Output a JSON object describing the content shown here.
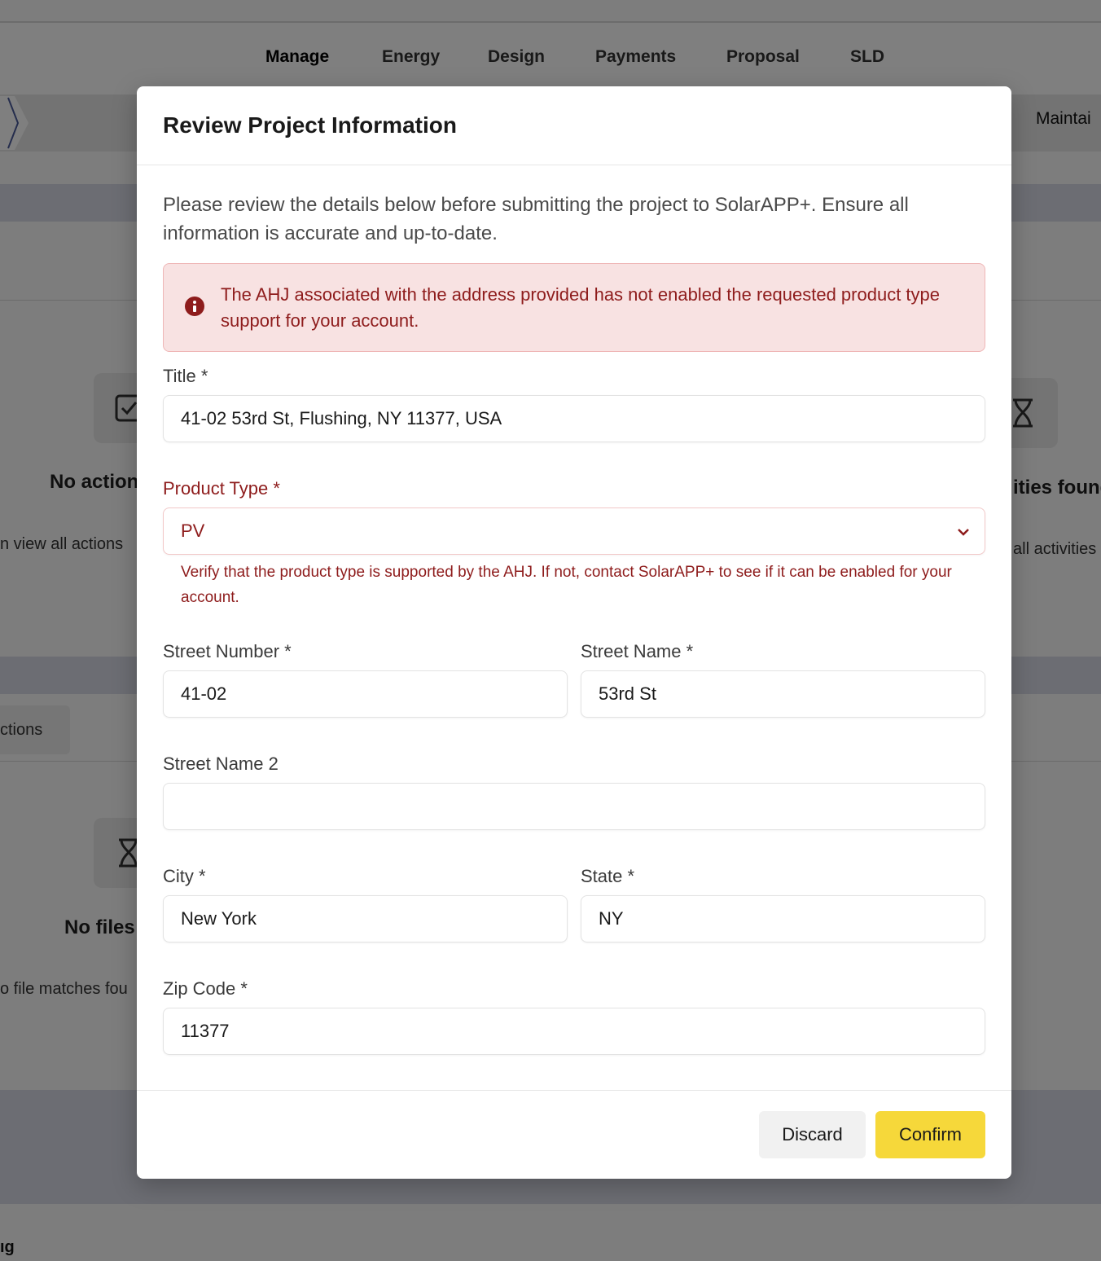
{
  "background": {
    "nav_tabs": [
      "Manage",
      "Energy",
      "Design",
      "Payments",
      "Proposal",
      "SLD"
    ],
    "stage_right_label": "Maintai",
    "actions_panel": {
      "title": "No action",
      "subtitle": "n view all actions"
    },
    "activities_panel": {
      "title": "ities found",
      "subtitle": "all activities"
    },
    "actions_tab": "ctions",
    "files_panel": {
      "title": "No files",
      "subtitle": "o file matches fou"
    },
    "bottom_label": "ıg"
  },
  "modal": {
    "title": "Review Project Information",
    "intro": "Please review the details below before submitting the project to SolarAPP+. Ensure all information is accurate and up-to-date.",
    "alert": {
      "icon": "info-circle-icon",
      "text": "The AHJ associated with the address provided has not enabled the requested product type support for your account.",
      "color": "#8e1c1c",
      "background": "#f8e2e2"
    },
    "fields": {
      "title": {
        "label": "Title *",
        "value": "41-02 53rd St, Flushing, NY 11377, USA"
      },
      "product_type": {
        "label": "Product Type *",
        "value": "PV",
        "helper": "Verify that the product type is supported by the AHJ. If not, contact SolarAPP+ to see if it can be enabled for your account."
      },
      "street_number": {
        "label": "Street Number *",
        "value": "41-02"
      },
      "street_name": {
        "label": "Street Name *",
        "value": "53rd St"
      },
      "street_name_2": {
        "label": "Street Name 2",
        "value": ""
      },
      "city": {
        "label": "City *",
        "value": "New York"
      },
      "state": {
        "label": "State *",
        "value": "NY"
      },
      "zip": {
        "label": "Zip Code *",
        "value": "11377"
      }
    },
    "buttons": {
      "discard": "Discard",
      "confirm": "Confirm"
    },
    "colors": {
      "confirm": "#f6d83a",
      "error": "#8e1c1c"
    }
  }
}
